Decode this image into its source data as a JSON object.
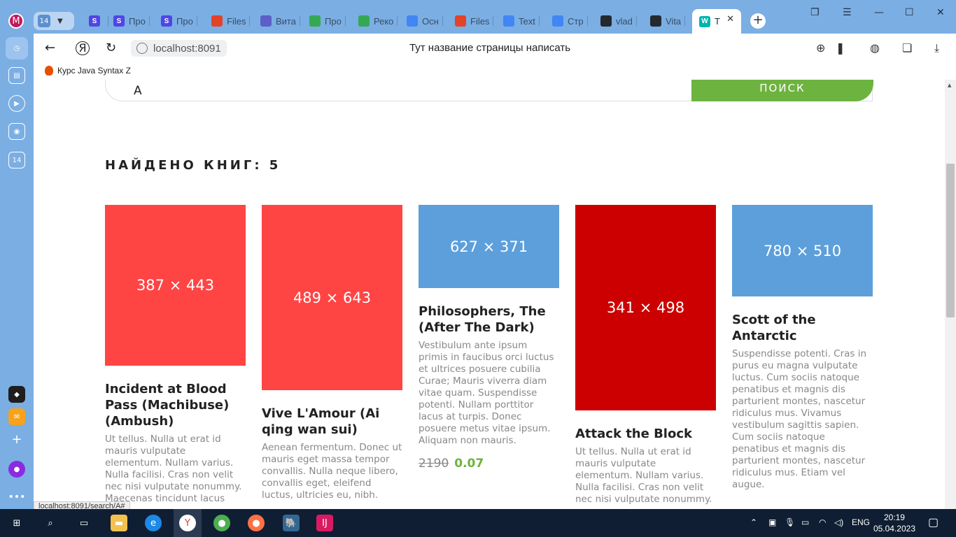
{
  "browser": {
    "profile_letter": "M",
    "tab_group_count": "14",
    "tabs": [
      {
        "label": "",
        "fav": "S",
        "color": "#4f46e5"
      },
      {
        "label": "Про",
        "fav": "S",
        "color": "#4f46e5"
      },
      {
        "label": "Про",
        "fav": "S",
        "color": "#4f46e5"
      },
      {
        "label": "Files",
        "fav": "",
        "color": "#e24329"
      },
      {
        "label": "Вита",
        "fav": "",
        "color": "#5b5fc7"
      },
      {
        "label": "Про",
        "fav": "",
        "color": "#34a853"
      },
      {
        "label": "Реко",
        "fav": "",
        "color": "#34a853"
      },
      {
        "label": "Осн",
        "fav": "",
        "color": "#4285f4"
      },
      {
        "label": "Files",
        "fav": "",
        "color": "#e24329"
      },
      {
        "label": "Text",
        "fav": "",
        "color": "#4285f4"
      },
      {
        "label": "Стр",
        "fav": "",
        "color": "#4285f4"
      },
      {
        "label": "vlad",
        "fav": "",
        "color": "#24292f"
      },
      {
        "label": "Vita",
        "fav": "",
        "color": "#24292f"
      }
    ],
    "active_tab": {
      "label": "Т",
      "fav": "W",
      "color": "#00b4ae"
    },
    "url": "localhost:8091",
    "page_title": "Тут название страницы написать",
    "bookmark": "Курс Java Syntax Z",
    "sidebar_badge": "14",
    "status_url": "localhost:8091/search/A#"
  },
  "search": {
    "query": "A",
    "button_label": "ПОИСК"
  },
  "results": {
    "heading": "НАЙДЕНО КНИГ: 5",
    "books": [
      {
        "cover_label": "387 × 443",
        "cover_color": "#ff4444",
        "title": "Incident at Blood Pass (Machibuse) (Ambush)",
        "description": "Ut tellus. Nulla ut erat id mauris vulputate elementum. Nullam varius. Nulla facilisi. Cras non velit nec nisi vulputate nonummy. Maecenas tincidunt lacus"
      },
      {
        "cover_label": "489 × 643",
        "cover_color": "#ff4444",
        "title": "Vive L'Amour (Ai qing wan sui)",
        "description": "Aenean fermentum. Donec ut mauris eget massa tempor convallis. Nulla neque libero, convallis eget, eleifend luctus, ultricies eu, nibh."
      },
      {
        "cover_label": "627 × 371",
        "cover_color": "#5c9fdb",
        "title": "Philosophers, The (After The Dark)",
        "description": "Vestibulum ante ipsum primis in faucibus orci luctus et ultrices posuere cubilia Curae; Mauris viverra diam vitae quam. Suspendisse potenti. Nullam porttitor lacus at turpis. Donec posuere metus vitae ipsum. Aliquam non mauris.",
        "old_price": "2190",
        "new_price": "0.07"
      },
      {
        "cover_label": "341 × 498",
        "cover_color": "#cc0000",
        "title": "Attack the Block",
        "description": "Ut tellus. Nulla ut erat id mauris vulputate elementum. Nullam varius. Nulla facilisi. Cras non velit nec nisi vulputate nonummy."
      },
      {
        "cover_label": "780 × 510",
        "cover_color": "#5c9fdb",
        "title": "Scott of the Antarctic",
        "description": "Suspendisse potenti. Cras in purus eu magna vulputate luctus. Cum sociis natoque penatibus et magnis dis parturient montes, nascetur ridiculus mus. Vivamus vestibulum sagittis sapien. Cum sociis natoque penatibus et magnis dis parturient montes, nascetur ridiculus mus. Etiam vel augue."
      }
    ]
  },
  "taskbar": {
    "language": "ENG",
    "time": "20:19",
    "date": "05.04.2023"
  }
}
